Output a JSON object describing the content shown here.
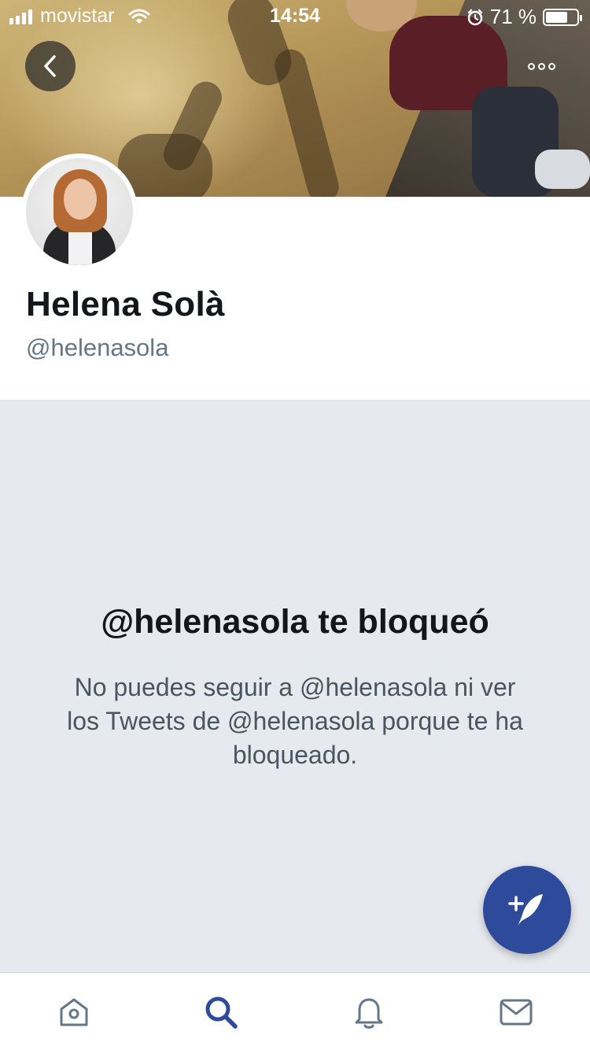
{
  "status_bar": {
    "carrier": "movistar",
    "time": "14:54",
    "battery_percent": "71 %",
    "battery_level": 0.71
  },
  "header": {
    "back_icon": "chevron-left-icon",
    "more_icon": "more-horizontal-icon"
  },
  "profile": {
    "display_name": "Helena Solà",
    "handle": "@helenasola"
  },
  "blocked_notice": {
    "title": "@helenasola te bloqueó",
    "description": "No puedes seguir a @helenasola ni ver los Tweets de @helenasola porque te ha bloqueado."
  },
  "compose": {
    "icon": "compose-tweet-icon",
    "color": "#2e4a9b"
  },
  "tab_bar": {
    "tabs": [
      {
        "name": "home",
        "icon": "home-icon",
        "active": false
      },
      {
        "name": "search",
        "icon": "search-icon",
        "active": true
      },
      {
        "name": "notifications",
        "icon": "bell-icon",
        "active": false
      },
      {
        "name": "messages",
        "icon": "mail-icon",
        "active": false
      }
    ],
    "active_color": "#2e4a9b",
    "inactive_color": "#657786"
  }
}
